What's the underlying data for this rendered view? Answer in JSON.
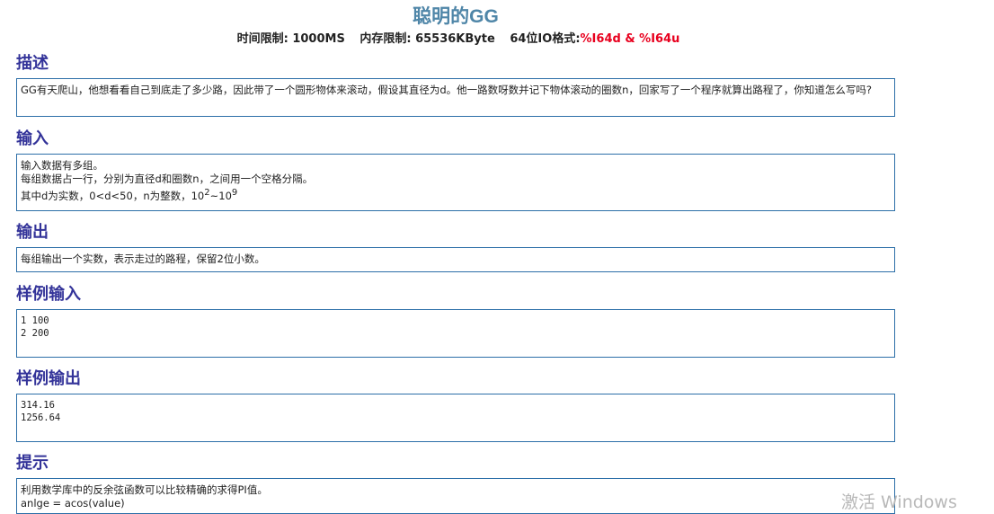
{
  "problem": {
    "title_cn": "聪明的",
    "title_latin": "GG",
    "time_limit": "时间限制: 1000MS",
    "memory_limit": "内存限制: 65536KByte",
    "io_label": "64位IO格式:",
    "io_format": "%I64d & %I64u"
  },
  "sections": {
    "description": {
      "heading": "描述",
      "text": "GG有天爬山，他想看看自己到底走了多少路，因此带了一个圆形物体来滚动，假设其直径为d。他一路数呀数并记下物体滚动的圈数n，回家写了一个程序就算出路程了，你知道怎么写吗?"
    },
    "input": {
      "heading": "输入",
      "line1": "输入数据有多组。",
      "line2": "每组数据占一行，分别为直径d和圈数n，之间用一个空格分隔。",
      "line3_prefix": "其中d为实数，0<d<50，n为整数，10",
      "exp1": "2",
      "range_sep": "~10",
      "exp2": "9"
    },
    "output": {
      "heading": "输出",
      "text": "每组输出一个实数，表示走过的路程，保留2位小数。"
    },
    "sample_input": {
      "heading": "样例输入",
      "lines": [
        "1 100",
        "2 200"
      ]
    },
    "sample_output": {
      "heading": "样例输出",
      "lines": [
        "314.16",
        "1256.64"
      ]
    },
    "hint": {
      "heading": "提示",
      "line1": "利用数学库中的反余弦函数可以比较精确的求得PI值。",
      "line2": "anlge = acos(value)"
    }
  },
  "watermark": "激活 Windows"
}
